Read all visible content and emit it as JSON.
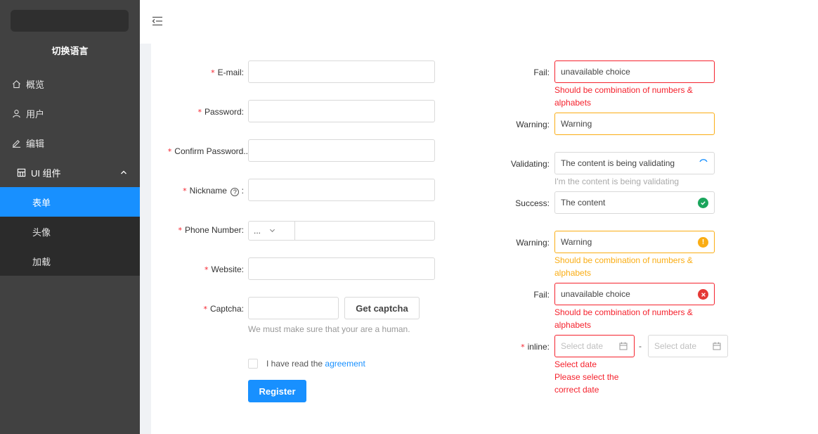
{
  "sidebar": {
    "lang_label": "切换语言",
    "items": [
      {
        "label": "概览",
        "icon": "home-icon"
      },
      {
        "label": "用户",
        "icon": "user-icon"
      },
      {
        "label": "编辑",
        "icon": "edit-icon"
      },
      {
        "label": "UI 组件",
        "icon": "appstore-icon"
      }
    ],
    "sub_items": [
      {
        "label": "表单"
      },
      {
        "label": "头像"
      },
      {
        "label": "加载"
      }
    ]
  },
  "form": {
    "email_label": "E-mail",
    "password_label": "Password",
    "confirm_label": "Confirm Password",
    "nickname_label": "Nickname",
    "phone_label": "Phone Number",
    "phone_prefix": "...",
    "website_label": "Website",
    "captcha_label": "Captcha",
    "captcha_button": "Get captcha",
    "captcha_help": "We must make sure that your are a human.",
    "agreement_text": "I have read the",
    "agreement_link": "agreement",
    "register_button": "Register"
  },
  "validation": {
    "fail1": {
      "label": "Fail",
      "value": "unavailable choice",
      "help": "Should be combination of numbers &",
      "help2": "alphabets"
    },
    "warning1": {
      "label": "Warning",
      "value": "Warning"
    },
    "validating": {
      "label": "Validating",
      "value": "The content is being validating",
      "help": "I'm the content is being validating"
    },
    "success": {
      "label": "Success",
      "value": "The content"
    },
    "warning2": {
      "label": "Warning",
      "value": "Warning",
      "help": "Should be combination of numbers &",
      "help2": "alphabets"
    },
    "fail2": {
      "label": "Fail",
      "value": "unavailable choice",
      "help": "Should be combination of numbers &",
      "help2": "alphabets"
    },
    "inline": {
      "label": "inline",
      "placeholder1": "Select date",
      "placeholder2": "Select date",
      "separator": "-",
      "help1": "Select date",
      "help2": "Please select the",
      "help3": "correct date"
    }
  },
  "colors": {
    "primary": "#1890ff",
    "error": "#f5222d",
    "warning": "#faad14",
    "success": "#52c41a"
  }
}
